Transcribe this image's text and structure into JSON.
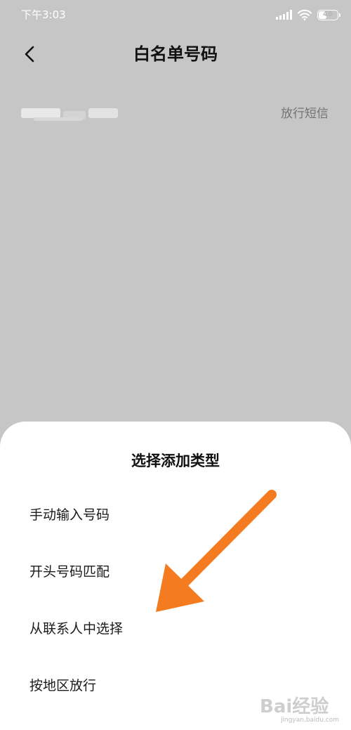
{
  "status_bar": {
    "time": "下午3:03",
    "battery_level": "46",
    "battery_percent": 46,
    "icons": [
      "signal-icon",
      "wifi-icon",
      "battery-icon"
    ]
  },
  "header": {
    "title": "白名单号码",
    "back_icon": "chevron-left-icon"
  },
  "whitelist": {
    "entries": [
      {
        "number": "",
        "status": "放行短信"
      }
    ]
  },
  "sheet": {
    "title": "选择添加类型",
    "options": [
      {
        "label": "手动输入号码"
      },
      {
        "label": "开头号码匹配"
      },
      {
        "label": "从联系人中选择"
      },
      {
        "label": "按地区放行"
      }
    ]
  },
  "annotation": {
    "color": "#f47b20"
  },
  "watermark": {
    "text": "Bai经验",
    "url": "jingyan.baidu.com"
  }
}
